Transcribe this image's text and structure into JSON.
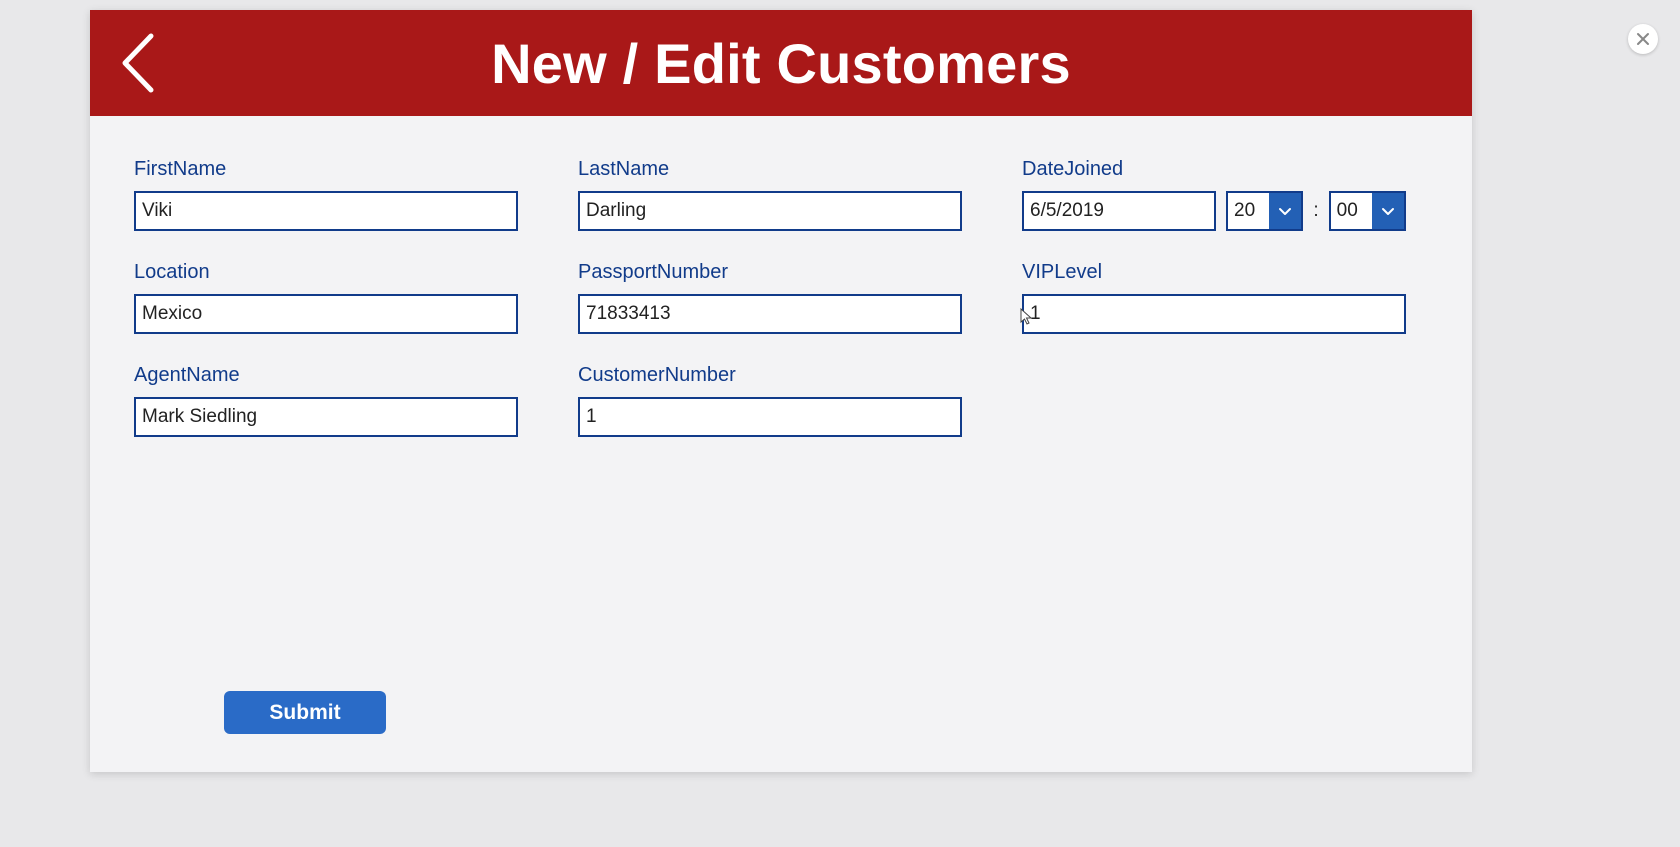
{
  "header": {
    "title": "New / Edit Customers"
  },
  "fields": {
    "firstName": {
      "label": "FirstName",
      "value": "Viki"
    },
    "lastName": {
      "label": "LastName",
      "value": "Darling"
    },
    "dateJoined": {
      "label": "DateJoined",
      "date": "6/5/2019",
      "hour": "20",
      "minute": "00"
    },
    "location": {
      "label": "Location",
      "value": "Mexico"
    },
    "passportNumber": {
      "label": "PassportNumber",
      "value": "71833413"
    },
    "vipLevel": {
      "label": "VIPLevel",
      "value": "1"
    },
    "agentName": {
      "label": "AgentName",
      "value": "Mark Siedling"
    },
    "customerNumber": {
      "label": "CustomerNumber",
      "value": "1"
    }
  },
  "timeSeparator": ":",
  "buttons": {
    "submit": "Submit"
  },
  "colors": {
    "headerBg": "#a91818",
    "primaryBlue": "#2360b5",
    "labelBlue": "#113b8a"
  }
}
